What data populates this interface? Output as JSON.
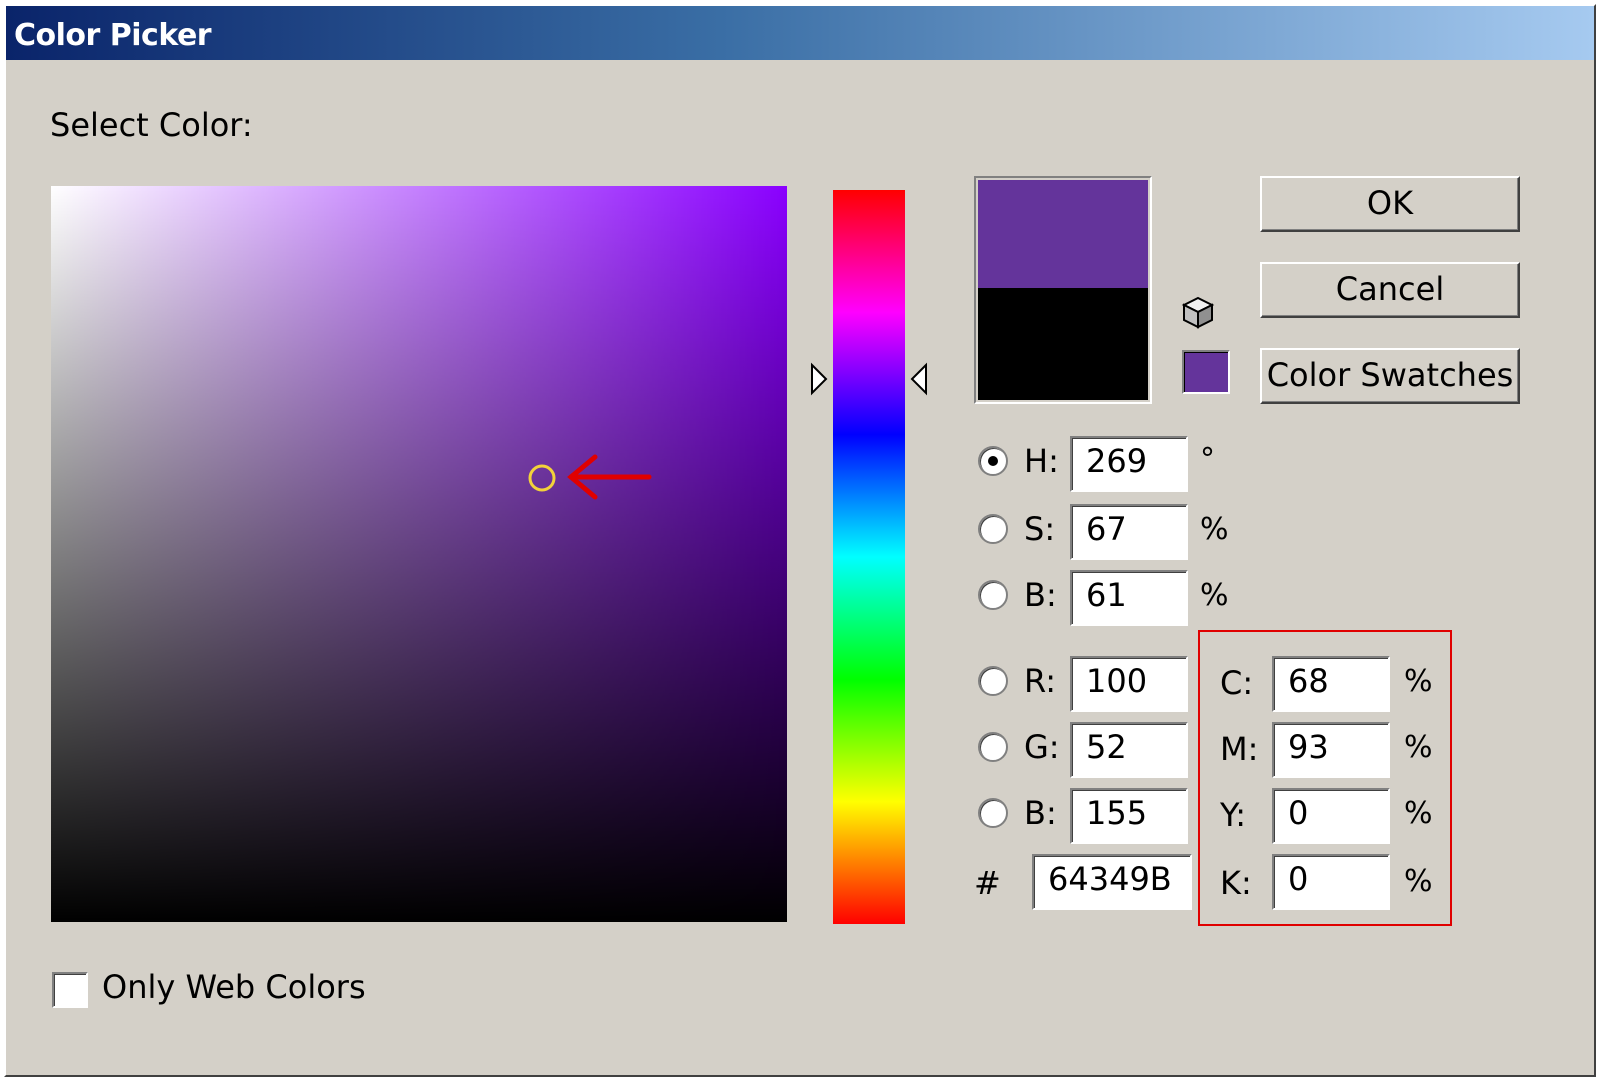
{
  "window": {
    "title": "Color Picker"
  },
  "select_label": "Select Color:",
  "selected_color": "#64349B",
  "hue_color": "#8a00ff",
  "color_preview": {
    "new_color": "#64349B",
    "previous_color": "#000000"
  },
  "buttons": {
    "ok": "OK",
    "cancel": "Cancel",
    "swatches": "Color Swatches"
  },
  "hsb": [
    {
      "key": "H",
      "label": "H:",
      "value": "269",
      "unit": "°",
      "selected": true
    },
    {
      "key": "S",
      "label": "S:",
      "value": "67",
      "unit": "%",
      "selected": false
    },
    {
      "key": "B",
      "label": "B:",
      "value": "61",
      "unit": "%",
      "selected": false
    }
  ],
  "rgb": [
    {
      "key": "R",
      "label": "R:",
      "value": "100",
      "selected": false
    },
    {
      "key": "G",
      "label": "G:",
      "value": "52",
      "selected": false
    },
    {
      "key": "B",
      "label": "B:",
      "value": "155",
      "selected": false
    }
  ],
  "cmyk": [
    {
      "key": "C",
      "label": "C:",
      "value": "68",
      "unit": "%"
    },
    {
      "key": "M",
      "label": "M:",
      "value": "93",
      "unit": "%"
    },
    {
      "key": "Y",
      "label": "Y:",
      "value": "0",
      "unit": "%"
    },
    {
      "key": "K",
      "label": "K:",
      "value": "0",
      "unit": "%"
    }
  ],
  "hex": {
    "label": "#",
    "value": "64349B"
  },
  "web_colors": {
    "label": "Only Web Colors",
    "checked": false
  },
  "highlight_color": "#e00000"
}
